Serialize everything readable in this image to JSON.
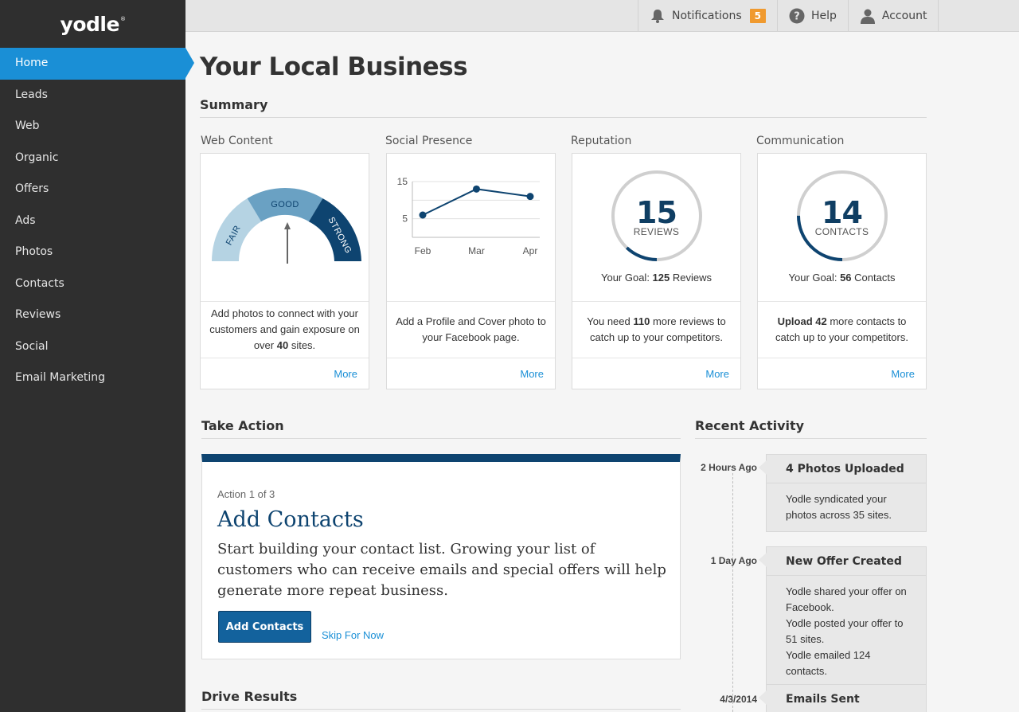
{
  "brand": {
    "logo": "yodle",
    "reg": "®"
  },
  "sidebar": {
    "items": [
      {
        "label": "Home",
        "active": true
      },
      {
        "label": "Leads"
      },
      {
        "label": "Web"
      },
      {
        "label": "Organic"
      },
      {
        "label": "Offers"
      },
      {
        "label": "Ads"
      },
      {
        "label": "Photos"
      },
      {
        "label": "Contacts"
      },
      {
        "label": "Reviews"
      },
      {
        "label": "Social"
      },
      {
        "label": "Email Marketing"
      }
    ]
  },
  "topbar": {
    "notifications_label": "Notifications",
    "notifications_count": "5",
    "help_label": "Help",
    "account_label": "Account"
  },
  "page_title": "Your Local Business",
  "summary": {
    "heading": "Summary",
    "web_content": {
      "title": "Web Content",
      "gauge_labels": [
        "FAIR",
        "GOOD",
        "STRONG"
      ],
      "gauge_level": "GOOD",
      "text_pre": "Add photos to connect with your customers and gain exposure on over ",
      "text_bold": "40",
      "text_post": " sites.",
      "more": "More"
    },
    "social": {
      "title": "Social Presence",
      "text": "Add a Profile and Cover photo to your Facebook page.",
      "more": "More"
    },
    "reputation": {
      "title": "Reputation",
      "value": "15",
      "unit": "REVIEWS",
      "progress": 0.12,
      "goal_pre": "Your Goal: ",
      "goal_bold": "125",
      "goal_post": " Reviews",
      "text_pre": "You need ",
      "text_bold": "110",
      "text_post": " more reviews to catch up to your competitors.",
      "more": "More"
    },
    "communication": {
      "title": "Communication",
      "value": "14",
      "unit": "CONTACTS",
      "progress": 0.25,
      "goal_pre": "Your Goal: ",
      "goal_bold": "56",
      "goal_post": " Contacts",
      "text_bold": "Upload 42",
      "text_post": " more contacts to catch up to your competitors.",
      "more": "More"
    }
  },
  "chart_data": {
    "type": "line",
    "categories": [
      "Feb",
      "Mar",
      "Apr"
    ],
    "values": [
      6,
      13,
      11
    ],
    "yticks": [
      "15",
      "5"
    ],
    "ylim": [
      0,
      15
    ],
    "grid": true
  },
  "take_action": {
    "heading": "Take Action",
    "step": "Action 1 of 3",
    "title": "Add Contacts",
    "body": "Start building your contact list. Growing your list of customers who can receive emails and special offers will help generate more repeat business.",
    "primary_button": "Add Contacts",
    "skip_link": "Skip For Now"
  },
  "drive_results": {
    "heading": "Drive Results"
  },
  "recent_activity": {
    "heading": "Recent Activity",
    "items": [
      {
        "time": "2 Hours Ago",
        "title": "4 Photos Uploaded",
        "lines": [
          "Yodle syndicated your photos across 35 sites."
        ]
      },
      {
        "time": "1 Day Ago",
        "title": "New Offer Created",
        "lines": [
          "Yodle shared your offer on Facebook.",
          "Yodle posted your offer to 51 sites.",
          "Yodle emailed 124 contacts."
        ]
      },
      {
        "time": "4/3/2014",
        "title": "Emails Sent",
        "lines": []
      }
    ]
  },
  "colors": {
    "accent": "#1a8fd6",
    "navy": "#0e4470",
    "badge": "#f09a2f",
    "sidebar": "#2f2f2f"
  }
}
